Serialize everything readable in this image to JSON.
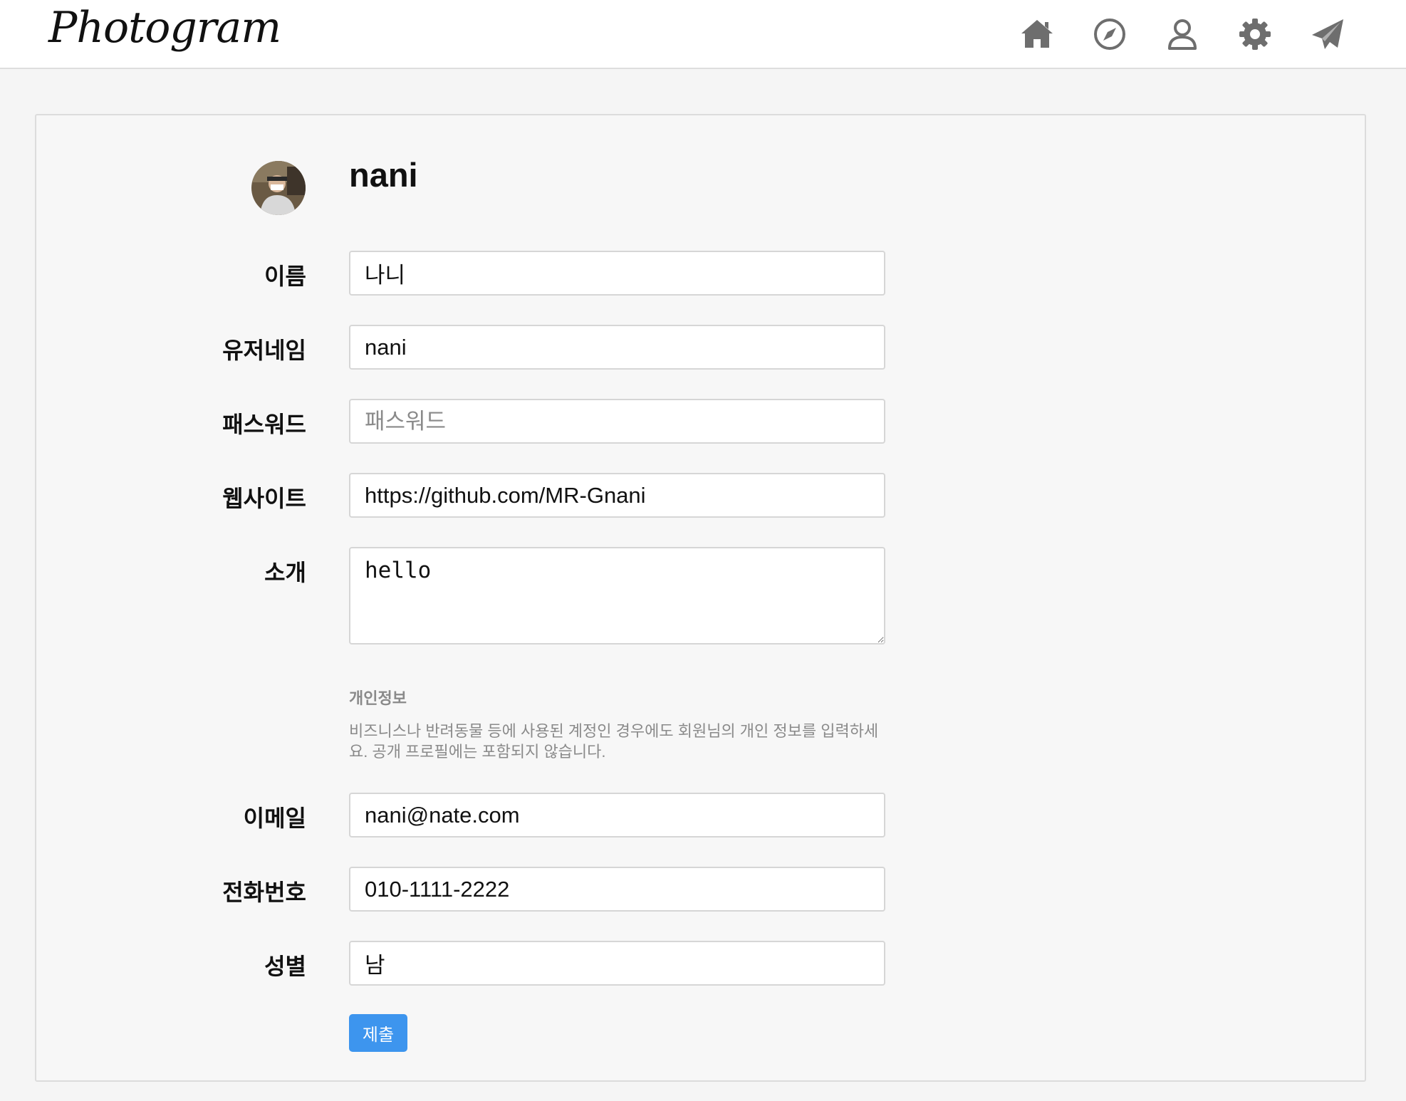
{
  "header": {
    "logo": "Photogram",
    "nav": [
      {
        "icon": "home-icon"
      },
      {
        "icon": "compass-icon"
      },
      {
        "icon": "user-icon"
      },
      {
        "icon": "gear-icon"
      },
      {
        "icon": "send-icon"
      }
    ]
  },
  "profile": {
    "username": "nani"
  },
  "form": {
    "name_label": "이름",
    "name_value": "나니",
    "username_label": "유저네임",
    "username_value": "nani",
    "password_label": "패스워드",
    "password_placeholder": "패스워드",
    "website_label": "웹사이트",
    "website_value": "https://github.com/MR-Gnani",
    "bio_label": "소개",
    "bio_value": "hello",
    "private_title": "개인정보",
    "private_desc": "비즈니스나 반려동물 등에 사용된 계정인 경우에도 회원님의 개인 정보를 입력하세요. 공개 프로필에는 포함되지 않습니다.",
    "email_label": "이메일",
    "email_value": "nani@nate.com",
    "phone_label": "전화번호",
    "phone_value": "010-1111-2222",
    "gender_label": "성별",
    "gender_value": "남",
    "submit_label": "제출"
  },
  "colors": {
    "accent": "#3d95ee",
    "icon": "#6e6e6e"
  }
}
